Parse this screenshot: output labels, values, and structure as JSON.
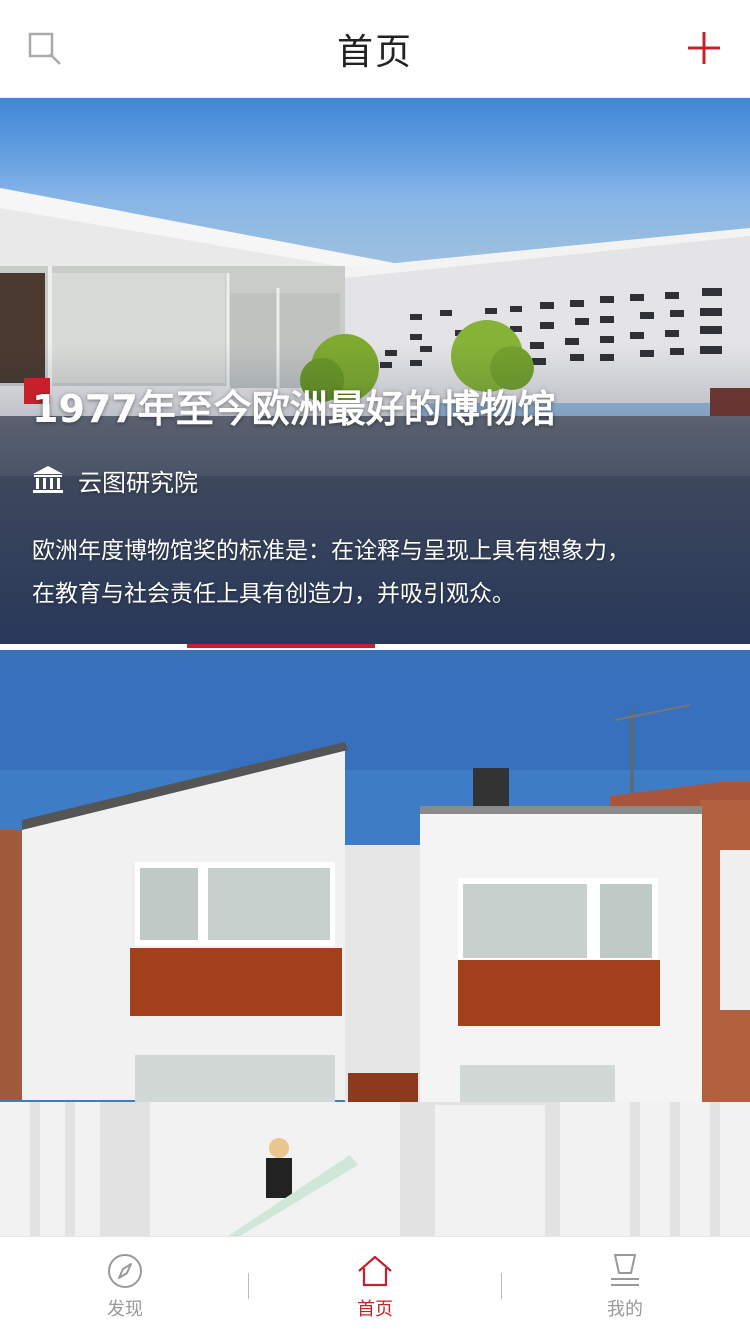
{
  "header": {
    "title": "首页",
    "search_icon": "search-icon",
    "add_icon": "plus-icon"
  },
  "featured": {
    "title": "1977年至今欧洲最好的博物馆",
    "source": "云图研究院",
    "source_icon": "museum-icon",
    "description_line1": "欧洲年度博物馆奖的标准是：在诠释与呈现上具有想象力，",
    "description_line2": "在教育与社会责任上具有创造力，并吸引观众。",
    "carousel_page": 2,
    "carousel_pages": 4
  },
  "tabbar": {
    "items": [
      {
        "label": "发现",
        "icon": "compass-icon",
        "active": false
      },
      {
        "label": "首页",
        "icon": "home-icon",
        "active": true
      },
      {
        "label": "我的",
        "icon": "profile-icon",
        "active": false
      }
    ]
  },
  "colors": {
    "accent": "#c8202b",
    "inactive": "#999999"
  }
}
